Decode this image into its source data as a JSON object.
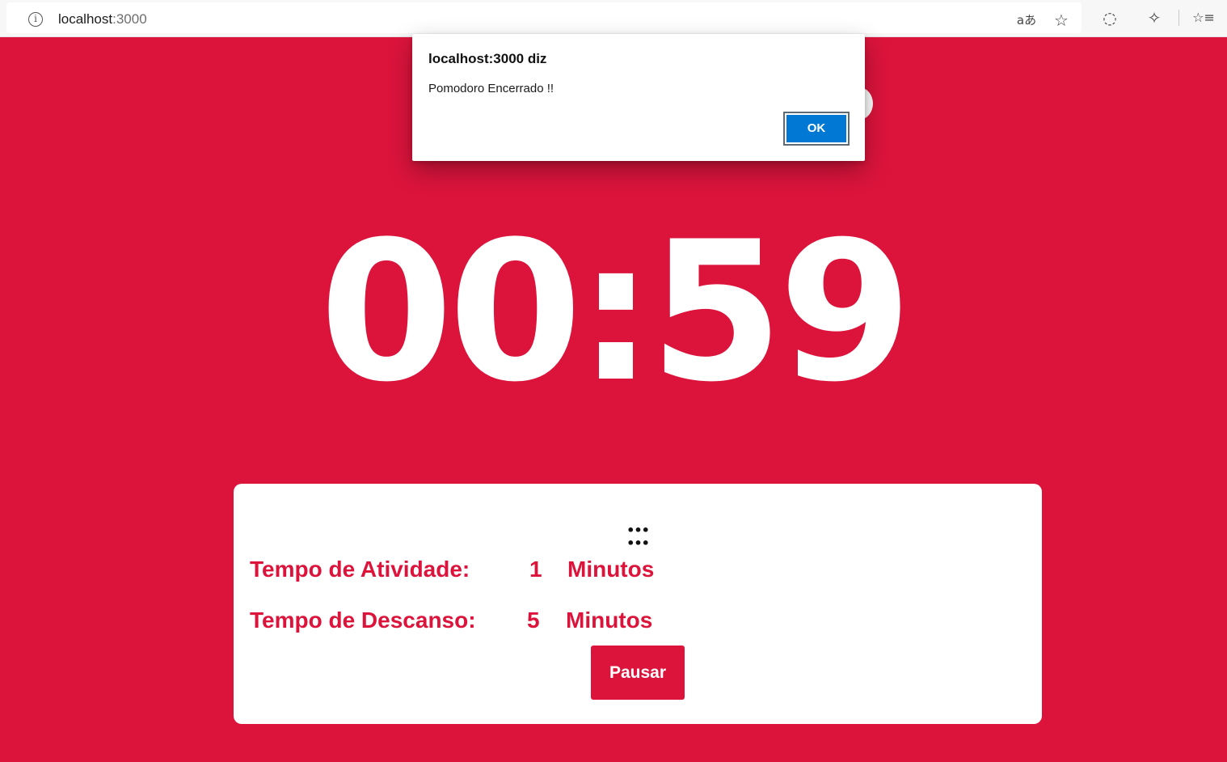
{
  "browser": {
    "url_host": "localhost",
    "url_port": ":3000",
    "icons": [
      "info-icon",
      "read-aloud-icon",
      "add-favorite-icon",
      "browser-essentials-icon",
      "extensions-icon",
      "favorites-icon"
    ],
    "info_glyph": "i",
    "read_aloud_glyph": "aあ",
    "add_favorite_glyph": "☆",
    "essentials_glyph": "◌",
    "extensions_glyph": "✧",
    "favorites_glyph": "☆≡"
  },
  "timer": {
    "display": "00:59"
  },
  "settings": {
    "dots": "••• •••",
    "activity": {
      "label": "Tempo de Atividade:",
      "value": "1",
      "unit": "Minutos"
    },
    "rest": {
      "label": "Tempo de Descanso:",
      "value": "5",
      "unit": "Minutos"
    },
    "pause_label": "Pausar"
  },
  "dialog": {
    "title": "localhost:3000 diz",
    "message": "Pomodoro Encerrado !!",
    "ok_label": "OK"
  },
  "colors": {
    "accent": "#dc143c",
    "card": "#ffffff",
    "dialog_button": "#0078d4"
  }
}
